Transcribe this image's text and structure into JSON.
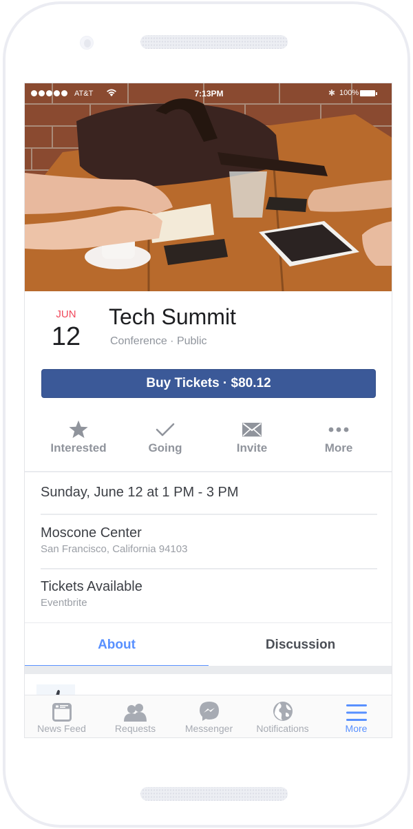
{
  "status_bar": {
    "signal_dots": 5,
    "carrier": "AT&T",
    "time": "7:13PM",
    "battery": "100%"
  },
  "hero": {
    "alt": "People at a wooden table with laptop bag, notebook, coffee cup, glass of water, phones and tablet"
  },
  "event": {
    "month": "JUN",
    "day": "12",
    "title": "Tech Summit",
    "meta": "Conference · Public",
    "buy_label": "Buy Tickets · $80.12"
  },
  "actions": [
    {
      "label": "Interested",
      "icon": "star-icon"
    },
    {
      "label": "Going",
      "icon": "check-icon"
    },
    {
      "label": "Invite",
      "icon": "envelope-icon"
    },
    {
      "label": "More",
      "icon": "more-dots-icon"
    }
  ],
  "details": {
    "datetime": "Sunday, June 12 at 1 PM - 3 PM",
    "venue": "Moscone Center",
    "address": "San Francisco, California 94103",
    "tickets_title": "Tickets Available",
    "tickets_source": "Eventbrite"
  },
  "tabs": [
    {
      "label": "About",
      "active": true
    },
    {
      "label": "Discussion",
      "active": false
    }
  ],
  "tabbar": [
    {
      "label": "News Feed",
      "icon": "news-feed-icon",
      "active": false
    },
    {
      "label": "Requests",
      "icon": "friend-requests-icon",
      "active": false
    },
    {
      "label": "Messenger",
      "icon": "messenger-icon",
      "active": false
    },
    {
      "label": "Notifications",
      "icon": "globe-icon",
      "active": false
    },
    {
      "label": "More",
      "icon": "hamburger-menu-icon",
      "active": true
    }
  ],
  "colors": {
    "brand_blue": "#3b5998",
    "accent_blue": "#5890ff",
    "date_red": "#f0475a",
    "muted_grey": "#90949c"
  }
}
